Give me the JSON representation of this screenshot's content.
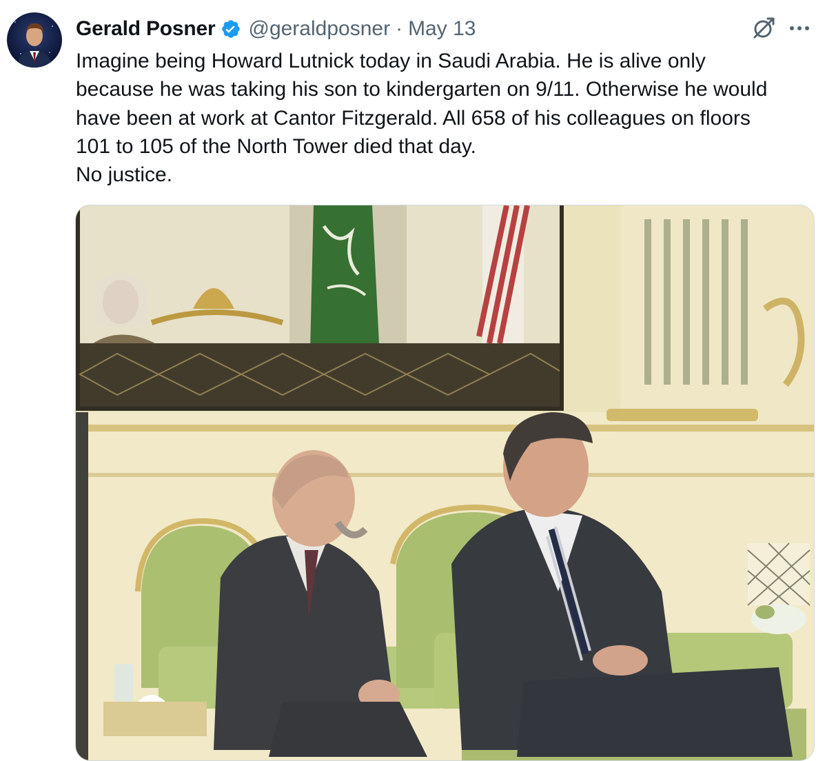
{
  "author": {
    "name": "Gerald Posner",
    "handle": "@geraldposner",
    "separator": "·",
    "date": "May 13",
    "verified": true,
    "avatar_alt": "Gerald Posner profile photo"
  },
  "tweet": {
    "text": "Imagine being Howard Lutnick today in Saudi Arabia. He is alive only\nbecause he was taking his son to kindergarten on 9/11. Otherwise he would\nhave been at work at Cantor Fitzgerald. All 658 of his colleagues on floors\n101 to 105 of the North Tower died that day.\nNo justice."
  },
  "icons": {
    "verified": "verified-badge-icon",
    "grok": "grok-icon",
    "more": "more-options-icon"
  },
  "colors": {
    "verified_blue": "#1d9bf0",
    "secondary_text": "#536471",
    "primary_text": "#0f1419"
  },
  "media": {
    "alt": "Photo of two men in suits seated on green sofas in an ornate room, with a TV screen behind them showing a meeting in front of Saudi and US flags"
  }
}
